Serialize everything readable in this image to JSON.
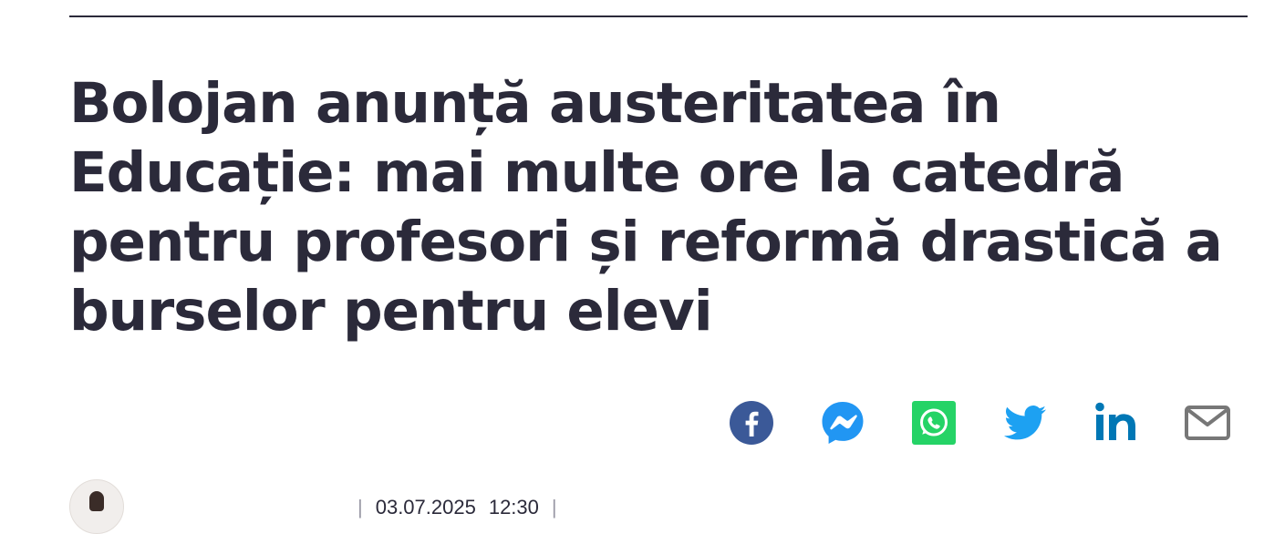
{
  "article": {
    "title": "Bolojan anunță austeritatea în Educație: mai multe ore la catedră pentru profesori și reformă drastică a burselor pentru elevi"
  },
  "share": {
    "buttons": [
      {
        "icon": "facebook-icon",
        "color": "#3b5998"
      },
      {
        "icon": "messenger-icon",
        "color": "#2196f3"
      },
      {
        "icon": "whatsapp-icon",
        "color": "#25d366"
      },
      {
        "icon": "twitter-icon",
        "color": "#1da1f2"
      },
      {
        "icon": "linkedin-icon",
        "color": "#0077b5"
      },
      {
        "icon": "email-icon",
        "color": "#777777"
      }
    ]
  },
  "meta": {
    "separator_left": "|",
    "date": "03.07.2025",
    "time": "12:30",
    "separator_right": "|"
  },
  "colors": {
    "text": "#2b2a3a",
    "rule": "#2b2a3a"
  }
}
